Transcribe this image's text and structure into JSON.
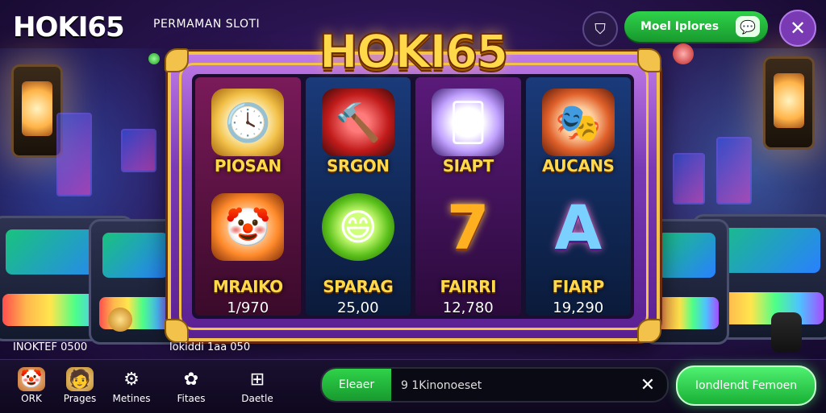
{
  "brand": {
    "logo": "HOKI65",
    "subtitle": "PERMAMAN SLOTI",
    "marquee": "HOKI65"
  },
  "header": {
    "shield_icon": "shield-icon",
    "green_button_label": "Moel Iplores",
    "green_button_icon": "chat-icon",
    "close_icon": "close-icon"
  },
  "reels": [
    {
      "top_label": "PIOSAN",
      "top_icon": "clock-icon",
      "bottom_label": "MRAIKO",
      "bottom_icon": "jester-icon",
      "value": "1/970"
    },
    {
      "top_label": "SRGON",
      "top_icon": "hammer-icon",
      "bottom_label": "SPARAG",
      "bottom_icon": "apple-icon",
      "value": "25,00"
    },
    {
      "top_label": "SIAPT",
      "top_icon": "card-icon",
      "bottom_label": "FAIRRI",
      "bottom_icon": "seven-icon",
      "value": "12,780"
    },
    {
      "top_label": "AUCANS",
      "top_icon": "clown-icon",
      "bottom_label": "FIARP",
      "bottom_icon": "letter-a-icon",
      "value": "19,290"
    }
  ],
  "info": {
    "left": "INOKTEF 0500",
    "middle": "lokiddi 1aa 050"
  },
  "nav": [
    {
      "label": "ORK",
      "icon": "jester-icon"
    },
    {
      "label": "Prages",
      "icon": "character-icon"
    },
    {
      "label": "Metines",
      "icon": "gear-icon"
    },
    {
      "label": "Fitaes",
      "icon": "gear-swirl-icon"
    },
    {
      "label": "Daetle",
      "icon": "image-plus-icon"
    }
  ],
  "search": {
    "button_label": "Eleaer",
    "value": "9 1Kinonoeset",
    "clear_icon": "close-icon"
  },
  "cta": {
    "label": "Iondlendt Femoen"
  },
  "colors": {
    "accent_gold": "#f3c24a",
    "accent_green": "#2fd24a",
    "frame_purple": "#7a3ab4"
  }
}
